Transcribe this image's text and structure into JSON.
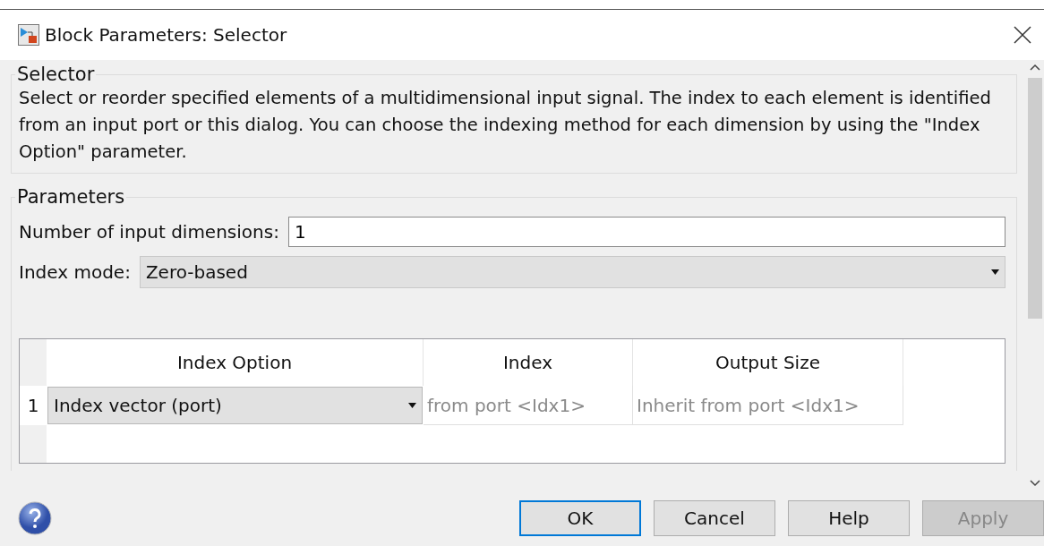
{
  "window": {
    "title": "Block Parameters: Selector"
  },
  "description_group": {
    "title": "Selector",
    "text": "Select or reorder specified elements of a multidimensional input signal. The index to each element is identified from an input port or this dialog. You can choose the indexing method for each dimension by using the \"Index Option\" parameter."
  },
  "parameters": {
    "title": "Parameters",
    "number_of_input_dimensions": {
      "label": "Number of input dimensions:",
      "value": "1"
    },
    "index_mode": {
      "label": "Index mode:",
      "value": "Zero-based"
    },
    "table": {
      "columns": [
        "Index Option",
        "Index",
        "Output Size"
      ],
      "rows": [
        {
          "number": "1",
          "index_option": "Index vector (port)",
          "index": "from port <Idx1>",
          "output_size": "Inherit from port <Idx1>"
        }
      ]
    }
  },
  "buttons": [
    {
      "label": "OK",
      "default": true,
      "disabled": false
    },
    {
      "label": "Cancel",
      "default": false,
      "disabled": false
    },
    {
      "label": "Help",
      "default": false,
      "disabled": false
    },
    {
      "label": "Apply",
      "default": false,
      "disabled": true
    }
  ]
}
